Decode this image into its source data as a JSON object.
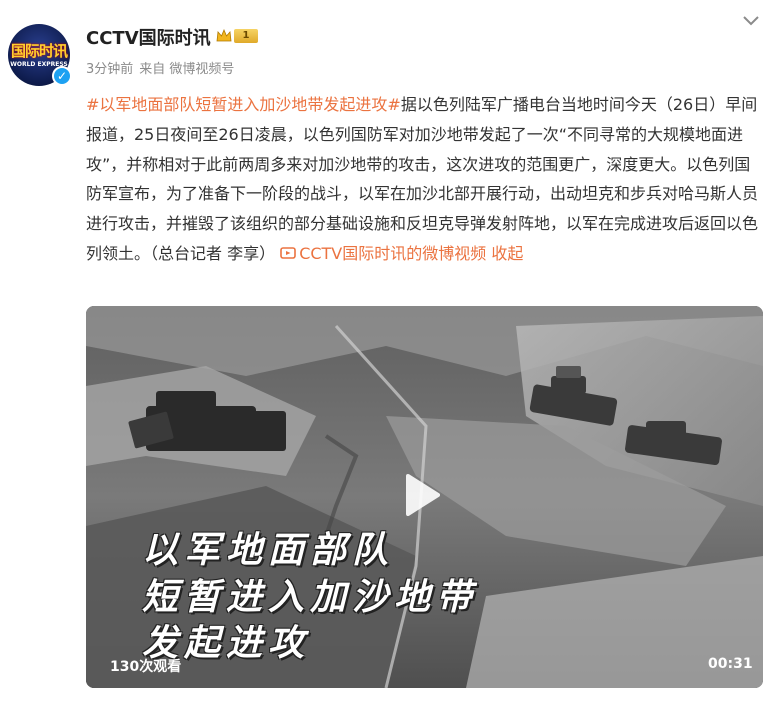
{
  "post": {
    "author": "CCTV国际时讯",
    "avatar_text_cn": "国际时讯",
    "avatar_text_en": "WORLD EXPRESS",
    "member_level": "1",
    "time": "3分钟前",
    "source": "来自 微博视频号",
    "topic": "#以军地面部队短暂进入加沙地带发起进攻#",
    "body": "据以色列陆军广播电台当地时间今天（26日）早间报道，25日夜间至26日凌晨，以色列国防军对加沙地带发起了一次“不同寻常的大规模地面进攻”，并称相对于此前两周多来对加沙地带的攻击，这次进攻的范围更广，深度更大。以色列国防军宣布，为了准备下一阶段的战斗，以军在加沙北部开展行动，出动坦克和步兵对哈马斯人员进行攻击，并摧毁了该组织的部分基础设施和反坦克导弹发射阵地，以军在完成进攻后返回以色列领土。（总台记者 李享）",
    "video_link": "CCTV国际时讯的微博视频",
    "collapse": "收起"
  },
  "video": {
    "overlay_lines": [
      "以军地面部队",
      "短暂进入加沙地带",
      "发起进攻"
    ],
    "views": "130次观看",
    "duration": "00:31"
  },
  "colors": {
    "accent": "#eb7340",
    "verified": "#1da1f2"
  },
  "icons": [
    "verified-icon",
    "crown-icon",
    "chevron-down-icon",
    "video-link-icon",
    "play-icon"
  ]
}
